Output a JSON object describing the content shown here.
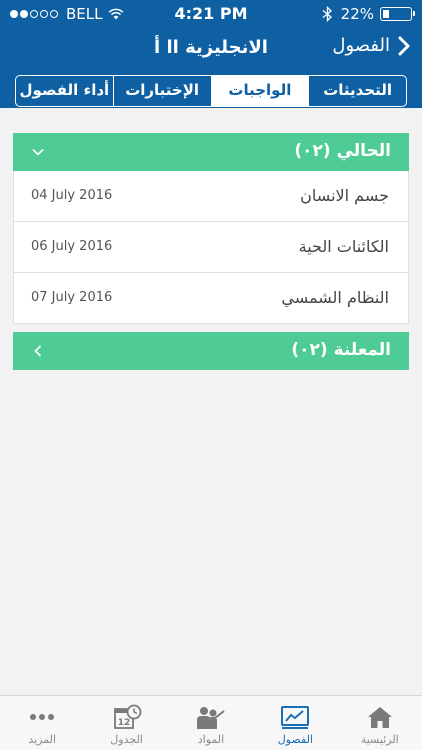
{
  "status_bar": {
    "carrier": "BELL",
    "time": "4:21 PM",
    "battery_percent": "22%",
    "battery_level": 0.22,
    "signal_dots_filled": 2,
    "signal_dots_total": 5
  },
  "nav": {
    "back_label": "الفصول",
    "title": "الانجليزية اا أ"
  },
  "segments": [
    {
      "label": "التحديثات",
      "active": false
    },
    {
      "label": "الواجبات",
      "active": true
    },
    {
      "label": "الإختبارات",
      "active": false
    },
    {
      "label": "أداء الفصول",
      "active": false
    }
  ],
  "current_section": {
    "title": "الحالي (٠٢)",
    "rows": [
      {
        "name": "جسم الانسان",
        "date": "04 July 2016"
      },
      {
        "name": "الكائنات الحية",
        "date": "06 July 2016"
      },
      {
        "name": "النظام الشمسي",
        "date": "07 July 2016"
      }
    ]
  },
  "announced_section": {
    "title": "المعلنة (٠٢)"
  },
  "tabbar": [
    {
      "label": "الرئيسية",
      "icon": "home-icon",
      "active": false
    },
    {
      "label": "الفصول",
      "icon": "chart-icon",
      "active": true
    },
    {
      "label": "المواد",
      "icon": "teacher-icon",
      "active": false
    },
    {
      "label": "الجدول",
      "icon": "calendar-icon",
      "calendar_day": "12",
      "active": false
    },
    {
      "label": "المزيد",
      "icon": "more-icon",
      "active": false
    }
  ],
  "colors": {
    "header_blue": "#0f5fa3",
    "section_green": "#4fcb96",
    "active_tab": "#1b6fb6"
  }
}
